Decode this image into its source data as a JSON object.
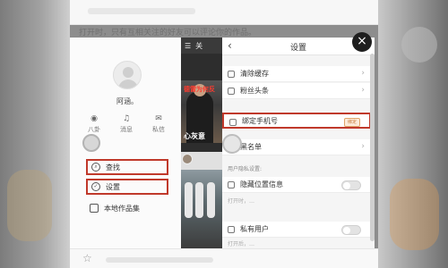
{
  "hint_text": "打开时，只有互相关注的好友可以评论你的作品。",
  "profile": {
    "username": "阿涵。",
    "stats": [
      {
        "icon": "eye-icon",
        "label": "八卦"
      },
      {
        "icon": "bell-icon",
        "label": "消息"
      },
      {
        "icon": "mail-icon",
        "label": "私信"
      }
    ],
    "menu": [
      {
        "icon": "search-icon",
        "label": "查找"
      },
      {
        "icon": "gear-icon",
        "label": "设置"
      },
      {
        "icon": "file-icon",
        "label": "本地作品集"
      }
    ]
  },
  "feed": {
    "header_label": "关",
    "red_caption": "德雷为何反",
    "white_caption": "心灰意"
  },
  "settings": {
    "title": "设置",
    "rows": [
      {
        "label": "清除缓存"
      },
      {
        "label": "粉丝头条"
      },
      {
        "label": "绑定手机号",
        "tag": "绑定"
      },
      {
        "label": "黑名单"
      }
    ],
    "section_label": "用户隐私设置:",
    "privacy_rows": [
      {
        "label": "隐藏位置信息"
      },
      {
        "label": "私有用户"
      }
    ],
    "note_1": "打开时，…",
    "note_2": "打开后，…"
  },
  "accent_red": "#c0392b"
}
